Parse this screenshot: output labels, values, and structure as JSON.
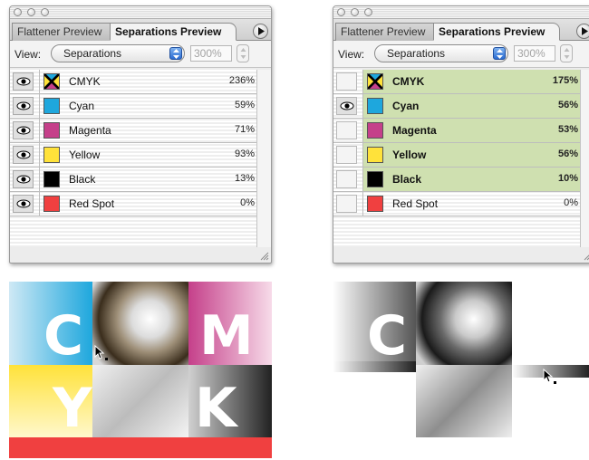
{
  "panels": [
    {
      "tabs": {
        "inactive": "Flattener Preview",
        "active": "Separations Preview"
      },
      "view_label": "View:",
      "view_select": "Separations",
      "zoom": "300%",
      "inks": [
        {
          "name": "CMYK",
          "pct": "236%",
          "eye": true,
          "color": "#000000"
        },
        {
          "name": "Cyan",
          "pct": "59%",
          "eye": true,
          "color": "#1ea7dd"
        },
        {
          "name": "Magenta",
          "pct": "71%",
          "eye": true,
          "color": "#c5408a"
        },
        {
          "name": "Yellow",
          "pct": "93%",
          "eye": true,
          "color": "#ffe23a"
        },
        {
          "name": "Black",
          "pct": "13%",
          "eye": true,
          "color": "#000000"
        },
        {
          "name": "Red Spot",
          "pct": "0%",
          "eye": true,
          "color": "#f04040"
        }
      ]
    },
    {
      "tabs": {
        "inactive": "Flattener Preview",
        "active": "Separations Preview"
      },
      "view_label": "View:",
      "view_select": "Separations",
      "zoom": "300%",
      "inks": [
        {
          "name": "CMYK",
          "pct": "175%",
          "eye": false,
          "color": "#000000"
        },
        {
          "name": "Cyan",
          "pct": "56%",
          "eye": true,
          "color": "#1ea7dd"
        },
        {
          "name": "Magenta",
          "pct": "53%",
          "eye": false,
          "color": "#c5408a"
        },
        {
          "name": "Yellow",
          "pct": "56%",
          "eye": false,
          "color": "#ffe23a"
        },
        {
          "name": "Black",
          "pct": "10%",
          "eye": false,
          "color": "#000000"
        },
        {
          "name": "Red Spot",
          "pct": "0%",
          "eye": false,
          "color": "#f04040"
        }
      ]
    }
  ],
  "preview_letters": {
    "c": "C",
    "m": "M",
    "y": "Y",
    "k": "K"
  },
  "colors": {
    "highlight": "#cfe0b0",
    "cyan": "#1ea7dd",
    "magenta": "#c5408a",
    "yellow": "#ffe23a",
    "red_spot": "#f04040"
  }
}
